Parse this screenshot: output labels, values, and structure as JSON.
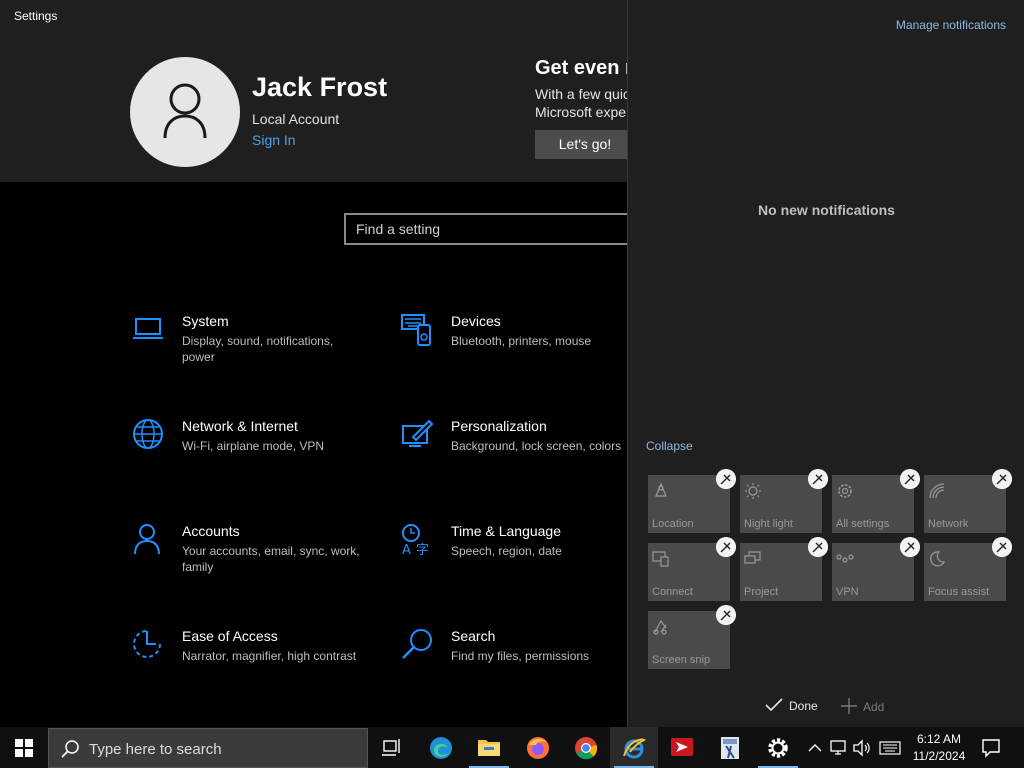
{
  "window": {
    "title": "Settings"
  },
  "profile": {
    "name": "Jack Frost",
    "account_type": "Local Account",
    "sign_in": "Sign In"
  },
  "promo": {
    "title": "Get even m",
    "text_line1": "With a few quic",
    "text_line2": "Microsoft expe",
    "button": "Let's go!"
  },
  "search": {
    "placeholder": "Find a setting"
  },
  "categories": [
    {
      "title": "System",
      "desc": "Display, sound, notifications, power",
      "icon": "laptop-icon"
    },
    {
      "title": "Devices",
      "desc": "Bluetooth, printers, mouse",
      "icon": "keyboard-icon"
    },
    {
      "title": "Network & Internet",
      "desc": "Wi-Fi, airplane mode, VPN",
      "icon": "globe-icon"
    },
    {
      "title": "Personalization",
      "desc": "Background, lock screen, colors",
      "icon": "paintbrush-icon"
    },
    {
      "title": "Accounts",
      "desc": "Your accounts, email, sync, work, family",
      "icon": "person-icon"
    },
    {
      "title": "Time & Language",
      "desc": "Speech, region, date",
      "icon": "time-language-icon"
    },
    {
      "title": "Ease of Access",
      "desc": "Narrator, magnifier, high contrast",
      "icon": "ease-of-access-icon"
    },
    {
      "title": "Search",
      "desc": "Find my files, permissions",
      "icon": "magnifier-icon"
    }
  ],
  "action_center": {
    "manage": "Manage notifications",
    "empty": "No new notifications",
    "collapse": "Collapse",
    "tiles": [
      {
        "label": "Location",
        "icon": "location-icon"
      },
      {
        "label": "Night light",
        "icon": "sun-icon"
      },
      {
        "label": "All settings",
        "icon": "gear-icon"
      },
      {
        "label": "Network",
        "icon": "network-icon"
      },
      {
        "label": "Connect",
        "icon": "connect-icon"
      },
      {
        "label": "Project",
        "icon": "project-icon"
      },
      {
        "label": "VPN",
        "icon": "vpn-icon"
      },
      {
        "label": "Focus assist",
        "icon": "moon-icon"
      },
      {
        "label": "Screen snip",
        "icon": "screen-snip-icon"
      }
    ],
    "done": "Done",
    "add": "Add"
  },
  "taskbar": {
    "search_placeholder": "Type here to search",
    "time": "6:12 AM",
    "date": "11/2/2024",
    "apps": [
      "task-view",
      "edge",
      "file-explorer",
      "firefox",
      "chrome",
      "ie-edge-legacy",
      "red-app",
      "calculator",
      "settings"
    ]
  },
  "colors": {
    "accent": "#1e90ff",
    "link": "#4aa3f0",
    "header_bg": "#1f1f1f",
    "tile_bg": "#4a4a4a"
  }
}
